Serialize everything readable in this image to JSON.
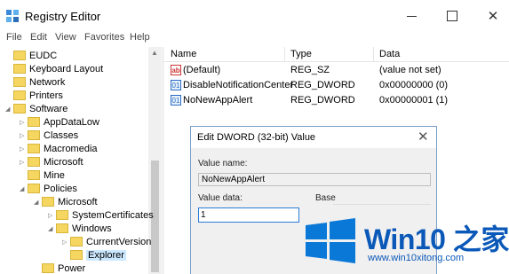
{
  "window": {
    "title": "Registry Editor"
  },
  "menu": [
    "File",
    "Edit",
    "View",
    "Favorites",
    "Help"
  ],
  "tree": [
    {
      "label": "EUDC",
      "indent": 0,
      "exp": "",
      "sel": false
    },
    {
      "label": "Keyboard Layout",
      "indent": 0,
      "exp": "",
      "sel": false
    },
    {
      "label": "Network",
      "indent": 0,
      "exp": "",
      "sel": false
    },
    {
      "label": "Printers",
      "indent": 0,
      "exp": "",
      "sel": false
    },
    {
      "label": "Software",
      "indent": 0,
      "exp": "◢",
      "sel": false
    },
    {
      "label": "AppDataLow",
      "indent": 1,
      "exp": "▷",
      "sel": false
    },
    {
      "label": "Classes",
      "indent": 1,
      "exp": "▷",
      "sel": false
    },
    {
      "label": "Macromedia",
      "indent": 1,
      "exp": "▷",
      "sel": false
    },
    {
      "label": "Microsoft",
      "indent": 1,
      "exp": "▷",
      "sel": false
    },
    {
      "label": "Mine",
      "indent": 1,
      "exp": "",
      "sel": false
    },
    {
      "label": "Policies",
      "indent": 1,
      "exp": "◢",
      "sel": false
    },
    {
      "label": "Microsoft",
      "indent": 2,
      "exp": "◢",
      "sel": false
    },
    {
      "label": "SystemCertificates",
      "indent": 3,
      "exp": "▷",
      "sel": false
    },
    {
      "label": "Windows",
      "indent": 3,
      "exp": "◢",
      "sel": false
    },
    {
      "label": "CurrentVersion",
      "indent": 4,
      "exp": "▷",
      "sel": false
    },
    {
      "label": "Explorer",
      "indent": 4,
      "exp": "",
      "sel": true
    },
    {
      "label": "Power",
      "indent": 2,
      "exp": "",
      "sel": false
    }
  ],
  "list": {
    "headers": {
      "name": "Name",
      "type": "Type",
      "data": "Data"
    },
    "rows": [
      {
        "icon": "ab",
        "kind": "sz",
        "name": "(Default)",
        "type": "REG_SZ",
        "data": "(value not set)"
      },
      {
        "icon": "01",
        "kind": "dw",
        "name": "DisableNotificationCenter",
        "type": "REG_DWORD",
        "data": "0x00000000 (0)"
      },
      {
        "icon": "01",
        "kind": "dw",
        "name": "NoNewAppAlert",
        "type": "REG_DWORD",
        "data": "0x00000001 (1)"
      }
    ]
  },
  "dialog": {
    "title": "Edit DWORD (32-bit) Value",
    "value_name_label": "Value name:",
    "value_name": "NoNewAppAlert",
    "value_data_label": "Value data:",
    "value_data": "1",
    "base_label": "Base"
  },
  "watermark": {
    "brand": "Win10 之家",
    "url": "www.win10xitong.com"
  },
  "colors": {
    "accent": "#0a58b8",
    "selection": "#cce8ff",
    "folder": "#f5d660"
  }
}
